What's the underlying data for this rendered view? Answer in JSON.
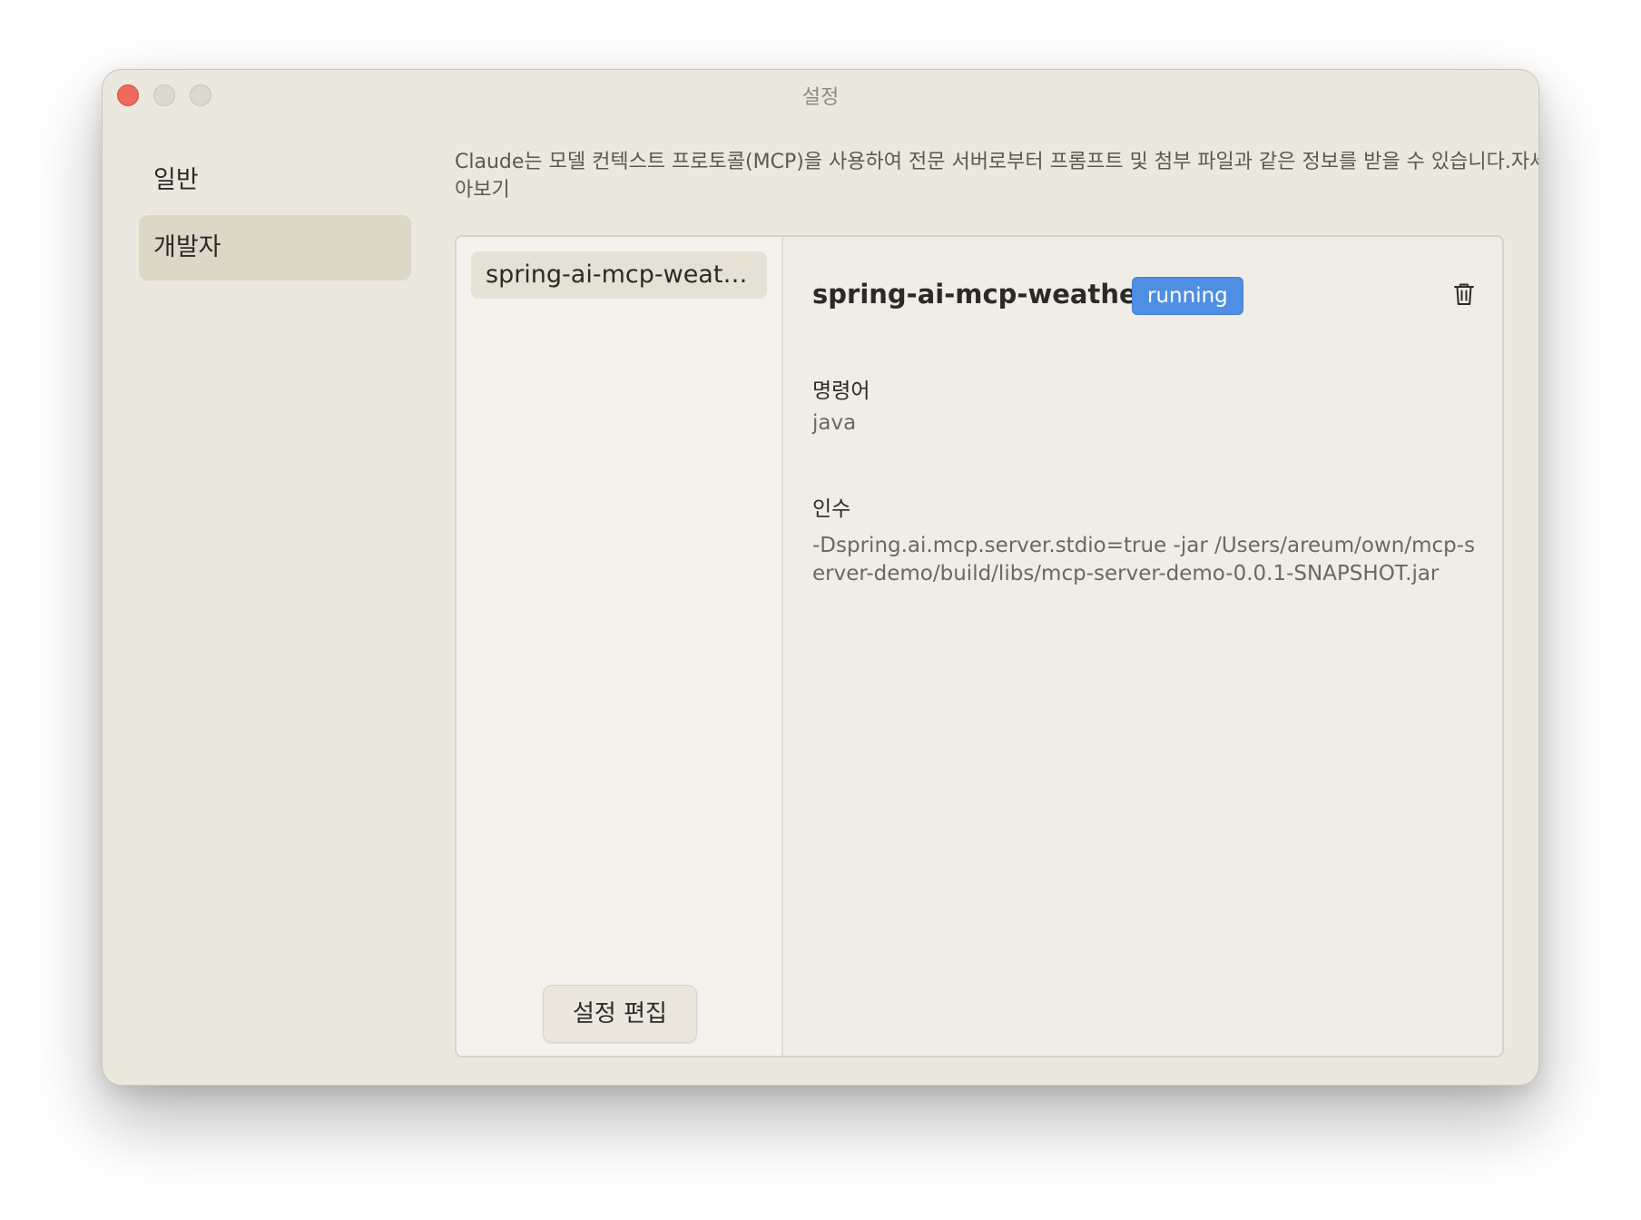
{
  "window": {
    "title": "설정"
  },
  "sidebar": {
    "items": [
      {
        "label": "일반"
      },
      {
        "label": "개발자"
      }
    ]
  },
  "intro": {
    "text": "Claude는 모델 컨텍스트 프로토콜(MCP)을 사용하여 전문 서버로부터 프롬프트 및 첨부 파일과 같은 정보를 받을 수 있습니다.",
    "link": "자세히 알아보기"
  },
  "servers": {
    "items": [
      {
        "name": "spring-ai-mcp-weather"
      }
    ],
    "edit_button": "설정 편집"
  },
  "detail": {
    "name": "spring-ai-mcp-weather",
    "status": "running",
    "status_color": "#4f8fe3",
    "delete_icon": "trash-icon",
    "command_label": "명령어",
    "command_value": "java",
    "args_label": "인수",
    "args_value": "-Dspring.ai.mcp.server.stdio=true -jar /Users/areum/own/mcp-server-demo/build/libs/mcp-server-demo-0.0.1-SNAPSHOT.jar"
  }
}
